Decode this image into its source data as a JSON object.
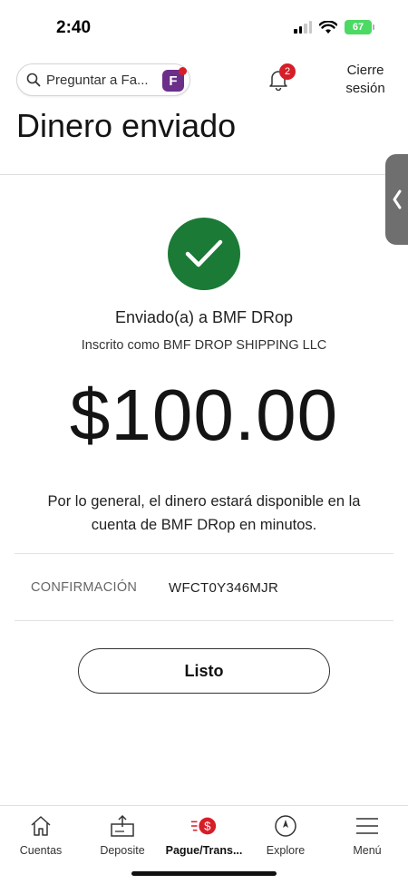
{
  "status_bar": {
    "time": "2:40",
    "battery": "67"
  },
  "header": {
    "search_placeholder": "Preguntar a Fa...",
    "fargo_badge_letter": "F",
    "notification_count": "2",
    "logout_line1": "Cierre",
    "logout_line2": "sesión"
  },
  "page": {
    "title": "Dinero enviado"
  },
  "confirmation": {
    "sent_to": "Enviado(a) a BMF DRop",
    "enrolled_as": "Inscrito como BMF DROP SHIPPING LLC",
    "amount": "$100.00",
    "note": "Por lo general, el dinero estará disponible en la cuenta de BMF DRop en minutos.",
    "confirmation_label": "CONFIRMACIÓN",
    "confirmation_code": "WFCT0Y346MJR",
    "done_label": "Listo"
  },
  "bottom_nav": {
    "items": [
      {
        "label": "Cuentas",
        "icon": "home-icon"
      },
      {
        "label": "Deposite",
        "icon": "deposit-icon"
      },
      {
        "label": "Pague/Trans...",
        "icon": "pay-transfer-icon"
      },
      {
        "label": "Explore",
        "icon": "compass-icon"
      },
      {
        "label": "Menú",
        "icon": "menu-icon"
      }
    ],
    "active_index": 2
  },
  "colors": {
    "success_green": "#1a7a36",
    "brand_red": "#d71e28",
    "fargo_purple": "#6b2f8a"
  }
}
